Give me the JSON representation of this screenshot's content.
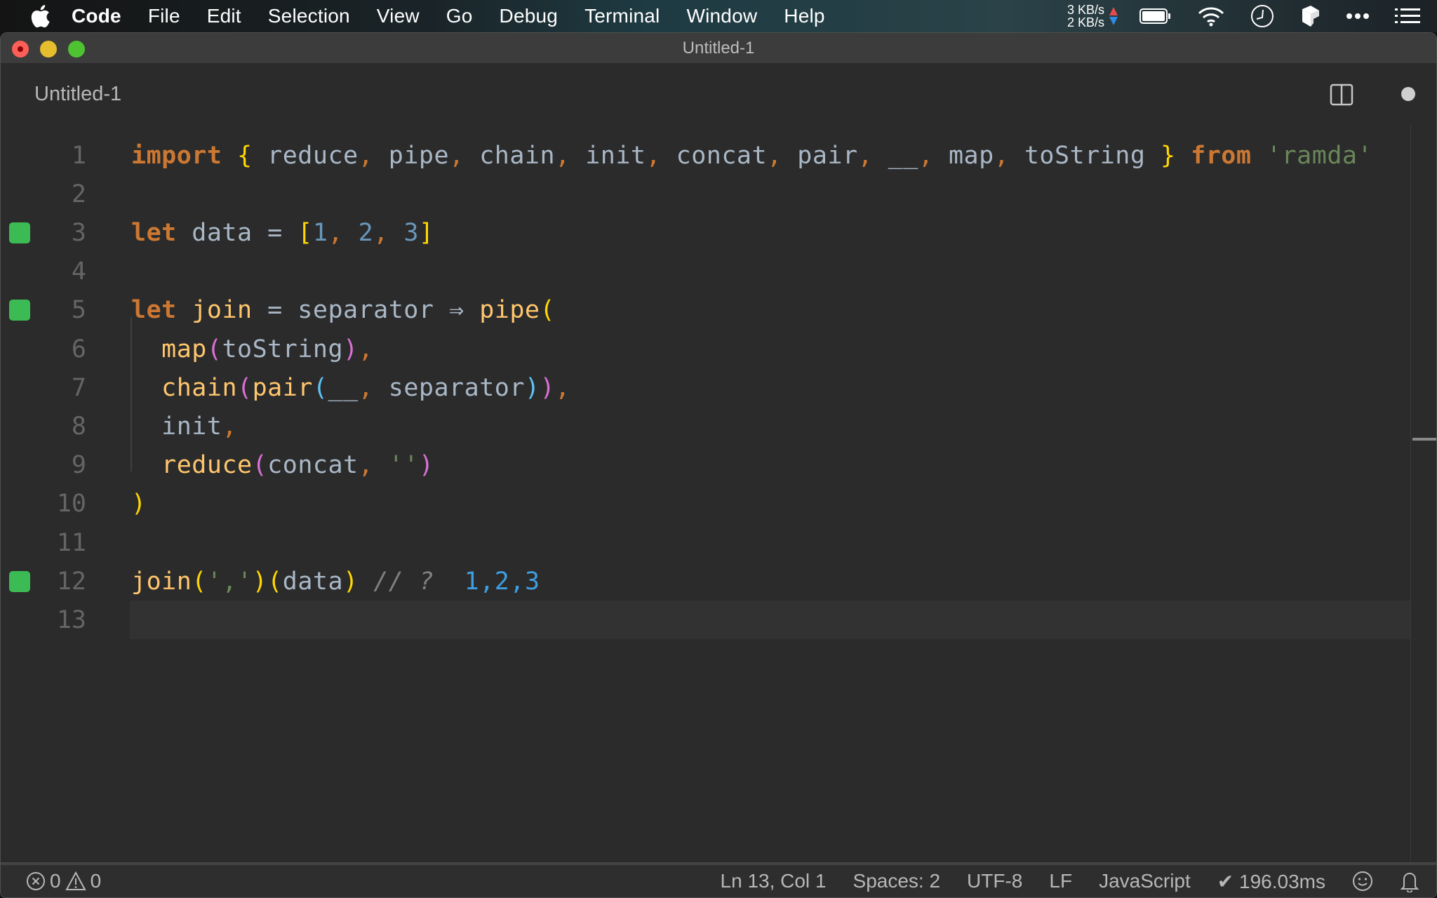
{
  "menubar": {
    "app_name": "Code",
    "items": [
      "File",
      "Edit",
      "Selection",
      "View",
      "Go",
      "Debug",
      "Terminal",
      "Window",
      "Help"
    ],
    "network": {
      "upload": "3 KB/s",
      "download": "2 KB/s"
    },
    "tray_icons": [
      "battery-icon",
      "wifi-icon",
      "clock-icon",
      "box-icon",
      "more-icon",
      "list-icon"
    ]
  },
  "window": {
    "title": "Untitled-1"
  },
  "tab": {
    "label": "Untitled-1",
    "dirty": true
  },
  "editor": {
    "current_line": 13,
    "lines": [
      {
        "n": "1",
        "marker": false,
        "tokens": [
          {
            "t": "import",
            "c": "kw"
          },
          {
            "t": " "
          },
          {
            "t": "{",
            "c": "brace"
          },
          {
            "t": " reduce",
            "c": "id"
          },
          {
            "t": ",",
            "c": "punc"
          },
          {
            "t": " pipe",
            "c": "id"
          },
          {
            "t": ",",
            "c": "punc"
          },
          {
            "t": " chain",
            "c": "id"
          },
          {
            "t": ",",
            "c": "punc"
          },
          {
            "t": " init",
            "c": "id"
          },
          {
            "t": ",",
            "c": "punc"
          },
          {
            "t": " concat",
            "c": "id"
          },
          {
            "t": ",",
            "c": "punc"
          },
          {
            "t": " pair",
            "c": "id"
          },
          {
            "t": ",",
            "c": "punc"
          },
          {
            "t": " __",
            "c": "id"
          },
          {
            "t": ",",
            "c": "punc"
          },
          {
            "t": " map",
            "c": "id"
          },
          {
            "t": ",",
            "c": "punc"
          },
          {
            "t": " toString ",
            "c": "id"
          },
          {
            "t": "}",
            "c": "brace"
          },
          {
            "t": " "
          },
          {
            "t": "from",
            "c": "kw"
          },
          {
            "t": " "
          },
          {
            "t": "'ramda'",
            "c": "str"
          }
        ]
      },
      {
        "n": "2",
        "marker": false,
        "tokens": []
      },
      {
        "n": "3",
        "marker": true,
        "tokens": [
          {
            "t": "let",
            "c": "kw"
          },
          {
            "t": " data = ",
            "c": "id"
          },
          {
            "t": "[",
            "c": "brace"
          },
          {
            "t": "1",
            "c": "num"
          },
          {
            "t": ",",
            "c": "punc"
          },
          {
            "t": " "
          },
          {
            "t": "2",
            "c": "num"
          },
          {
            "t": ",",
            "c": "punc"
          },
          {
            "t": " "
          },
          {
            "t": "3",
            "c": "num"
          },
          {
            "t": "]",
            "c": "brace"
          }
        ]
      },
      {
        "n": "4",
        "marker": false,
        "tokens": []
      },
      {
        "n": "5",
        "marker": true,
        "tokens": [
          {
            "t": "let",
            "c": "kw"
          },
          {
            "t": " "
          },
          {
            "t": "join",
            "c": "fn"
          },
          {
            "t": " = separator ",
            "c": "id"
          },
          {
            "t": "⇒",
            "c": "op"
          },
          {
            "t": " "
          },
          {
            "t": "pipe",
            "c": "fn"
          },
          {
            "t": "(",
            "c": "brace"
          }
        ]
      },
      {
        "n": "6",
        "marker": false,
        "tokens": [
          {
            "t": "  "
          },
          {
            "t": "map",
            "c": "fn"
          },
          {
            "t": "(",
            "c": "paren2"
          },
          {
            "t": "toString",
            "c": "id"
          },
          {
            "t": ")",
            "c": "paren2"
          },
          {
            "t": ",",
            "c": "punc"
          }
        ]
      },
      {
        "n": "7",
        "marker": false,
        "tokens": [
          {
            "t": "  "
          },
          {
            "t": "chain",
            "c": "fn"
          },
          {
            "t": "(",
            "c": "paren2"
          },
          {
            "t": "pair",
            "c": "fn"
          },
          {
            "t": "(",
            "c": "paren3"
          },
          {
            "t": "__",
            "c": "id"
          },
          {
            "t": ",",
            "c": "punc"
          },
          {
            "t": " separator",
            "c": "id"
          },
          {
            "t": ")",
            "c": "paren3"
          },
          {
            "t": ")",
            "c": "paren2"
          },
          {
            "t": ",",
            "c": "punc"
          }
        ]
      },
      {
        "n": "8",
        "marker": false,
        "tokens": [
          {
            "t": "  "
          },
          {
            "t": "init",
            "c": "id"
          },
          {
            "t": ",",
            "c": "punc"
          }
        ]
      },
      {
        "n": "9",
        "marker": false,
        "tokens": [
          {
            "t": "  "
          },
          {
            "t": "reduce",
            "c": "fn"
          },
          {
            "t": "(",
            "c": "paren2"
          },
          {
            "t": "concat",
            "c": "id"
          },
          {
            "t": ",",
            "c": "punc"
          },
          {
            "t": " "
          },
          {
            "t": "''",
            "c": "str"
          },
          {
            "t": ")",
            "c": "paren2"
          }
        ]
      },
      {
        "n": "10",
        "marker": false,
        "tokens": [
          {
            "t": ")",
            "c": "brace"
          }
        ]
      },
      {
        "n": "11",
        "marker": false,
        "tokens": []
      },
      {
        "n": "12",
        "marker": true,
        "tokens": [
          {
            "t": "join",
            "c": "fn"
          },
          {
            "t": "(",
            "c": "brace"
          },
          {
            "t": "','",
            "c": "str"
          },
          {
            "t": ")",
            "c": "brace"
          },
          {
            "t": "(",
            "c": "brace"
          },
          {
            "t": "data",
            "c": "id"
          },
          {
            "t": ")",
            "c": "brace"
          },
          {
            "t": " "
          },
          {
            "t": "// ?",
            "c": "cmt"
          },
          {
            "t": "  "
          },
          {
            "t": "1,2,3",
            "c": "result"
          }
        ]
      },
      {
        "n": "13",
        "marker": false,
        "tokens": []
      }
    ]
  },
  "statusbar": {
    "errors": "0",
    "warnings": "0",
    "position": "Ln 13, Col 1",
    "indentation": "Spaces: 2",
    "encoding": "UTF-8",
    "eol": "LF",
    "language": "JavaScript",
    "timing": "✔ 196.03ms"
  },
  "colors": {
    "marker_green": "#3cba54",
    "keyword": "#cc7832",
    "function": "#ffc66d",
    "string": "#6a8759",
    "number": "#6897bb",
    "result": "#3d9ee0"
  }
}
